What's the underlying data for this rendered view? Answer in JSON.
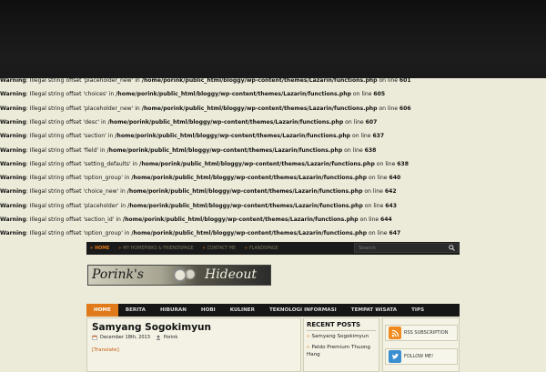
{
  "warnings": [
    {
      "label": "Warning",
      "msg": ": Illegal string offset 'placeholder_new' in ",
      "path": "/home/porink/public_html/bloggy/wp-content/themes/Lazarin/functions.php",
      "suffix": " on line ",
      "line": "601"
    },
    {
      "label": "Warning",
      "msg": ": Illegal string offset 'choices' in ",
      "path": "/home/porink/public_html/bloggy/wp-content/themes/Lazarin/functions.php",
      "suffix": " on line ",
      "line": "605"
    },
    {
      "label": "Warning",
      "msg": ": Illegal string offset 'placeholder_new' in ",
      "path": "/home/porink/public_html/bloggy/wp-content/themes/Lazarin/functions.php",
      "suffix": " on line ",
      "line": "606"
    },
    {
      "label": "Warning",
      "msg": ": Illegal string offset 'desc' in ",
      "path": "/home/porink/public_html/bloggy/wp-content/themes/Lazarin/functions.php",
      "suffix": " on line ",
      "line": "607"
    },
    {
      "label": "Warning",
      "msg": ": Illegal string offset 'section' in ",
      "path": "/home/porink/public_html/bloggy/wp-content/themes/Lazarin/functions.php",
      "suffix": " on line ",
      "line": "637"
    },
    {
      "label": "Warning",
      "msg": ": Illegal string offset 'field' in ",
      "path": "/home/porink/public_html/bloggy/wp-content/themes/Lazarin/functions.php",
      "suffix": " on line ",
      "line": "638"
    },
    {
      "label": "Warning",
      "msg": ": Illegal string offset 'setting_defaults' in ",
      "path": "/home/porink/public_html/bloggy/wp-content/themes/Lazarin/functions.php",
      "suffix": " on line ",
      "line": "638"
    },
    {
      "label": "Warning",
      "msg": ": Illegal string offset 'option_group' in ",
      "path": "/home/porink/public_html/bloggy/wp-content/themes/Lazarin/functions.php",
      "suffix": " on line ",
      "line": "640"
    },
    {
      "label": "Warning",
      "msg": ": Illegal string offset 'choice_new' in ",
      "path": "/home/porink/public_html/bloggy/wp-content/themes/Lazarin/functions.php",
      "suffix": " on line ",
      "line": "642"
    },
    {
      "label": "Warning",
      "msg": ": Illegal string offset 'placeholder' in ",
      "path": "/home/porink/public_html/bloggy/wp-content/themes/Lazarin/functions.php",
      "suffix": " on line ",
      "line": "643"
    },
    {
      "label": "Warning",
      "msg": ": Illegal string offset 'section_id' in ",
      "path": "/home/porink/public_html/bloggy/wp-content/themes/Lazarin/functions.php",
      "suffix": " on line ",
      "line": "644"
    },
    {
      "label": "Warning",
      "msg": ": Illegal string offset 'option_group' in ",
      "path": "/home/porink/public_html/bloggy/wp-content/themes/Lazarin/functions.php",
      "suffix": " on line ",
      "line": "647"
    }
  ],
  "topnav": {
    "items": [
      "HOME",
      "MY HOMEPINKS & FRIENDSPAGE",
      "CONTACT ME",
      "FLANDSPAGE"
    ]
  },
  "search": {
    "placeholder": "Search"
  },
  "logo": {
    "left": "Porink's",
    "right": "Hideout"
  },
  "mainmenu": {
    "items": [
      "HOME",
      "BERITA",
      "HIBURAN",
      "HOBI",
      "KULINER",
      "TEKNOLOGI INFORMASI",
      "TEMPAT WISATA",
      "TIPS"
    ]
  },
  "post": {
    "title": "Samyang Sogokimyun",
    "date": "December 18th, 2013",
    "author": "Porink",
    "translate": "[Translate]"
  },
  "recent": {
    "title": "RECENT POSTS",
    "items": [
      "Samyang Sogokimyun",
      "Paldo Premium Thuong Hang"
    ]
  },
  "subscribe": {
    "rss": "RSS SUBSCRIPTION",
    "follow": "FOLLOW ME!"
  },
  "colors": {
    "accent": "#e07a1a",
    "dark": "#161616",
    "bg": "#ecebd9"
  }
}
